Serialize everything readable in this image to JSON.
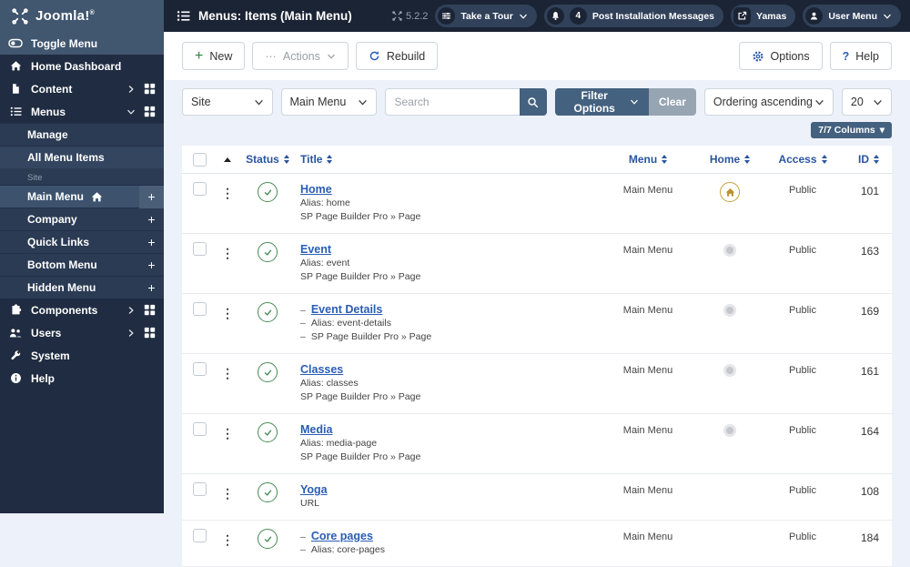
{
  "topbar": {
    "logo": "Joomla!",
    "logo_reg": "®",
    "title": "Menus: Items (Main Menu)",
    "version": "5.2.2",
    "take_a_tour": "Take a Tour",
    "messages_count": "4",
    "messages_label": "Post Installation Messages",
    "site_link": "Yamas",
    "user_menu": "User Menu"
  },
  "sidebar": {
    "toggle_label": "Toggle Menu",
    "home_dashboard": "Home Dashboard",
    "content": "Content",
    "menus": "Menus",
    "manage": "Manage",
    "all_menu_items": "All Menu Items",
    "site_section": "Site",
    "site_menus": [
      {
        "label": "Main Menu"
      },
      {
        "label": "Company"
      },
      {
        "label": "Quick Links"
      },
      {
        "label": "Bottom Menu"
      },
      {
        "label": "Hidden Menu"
      }
    ],
    "add_label": "+",
    "components": "Components",
    "users": "Users",
    "system": "System",
    "help": "Help"
  },
  "toolbar": {
    "new_label": "New",
    "new_plus": "+",
    "actions_label": "Actions",
    "actions_dots": "···",
    "rebuild_label": "Rebuild",
    "options_label": "Options",
    "help_label": "Help",
    "help_qmark": "?"
  },
  "filters": {
    "site_select": "Site",
    "menu_select": "Main Menu",
    "search_placeholder": "Search",
    "filter_options": "Filter Options",
    "clear": "Clear",
    "ordering_select": "Ordering ascending",
    "limit_select": "20",
    "columns_button": "7/7 Columns",
    "columns_caret": "▾"
  },
  "table": {
    "dash": "–",
    "headers": {
      "status": "Status",
      "title": "Title",
      "menu": "Menu",
      "home": "Home",
      "access": "Access",
      "id": "ID"
    },
    "rows": [
      {
        "title": "Home",
        "sub1": "Alias: home",
        "sub2": "SP Page Builder Pro » Page",
        "menu": "Main Menu",
        "home": "default",
        "access": "Public",
        "id": "101"
      },
      {
        "title": "Event",
        "sub1": "Alias: event",
        "sub2": "SP Page Builder Pro » Page",
        "menu": "Main Menu",
        "home": "not-default",
        "access": "Public",
        "id": "163"
      },
      {
        "title": "Event Details",
        "sub1": "Alias: event-details",
        "sub2": "SP Page Builder Pro » Page",
        "menu": "Main Menu",
        "home": "not-default",
        "access": "Public",
        "id": "169",
        "child": true
      },
      {
        "title": "Classes",
        "sub1": "Alias: classes",
        "sub2": "SP Page Builder Pro » Page",
        "menu": "Main Menu",
        "home": "not-default",
        "access": "Public",
        "id": "161"
      },
      {
        "title": "Media",
        "sub1": "Alias: media-page",
        "sub2": "SP Page Builder Pro » Page",
        "menu": "Main Menu",
        "home": "not-default",
        "access": "Public",
        "id": "164"
      },
      {
        "title": "Yoga",
        "sub1": "URL",
        "menu": "Main Menu",
        "home": "none",
        "access": "Public",
        "id": "108"
      },
      {
        "title": "Core pages",
        "sub1": "Alias: core-pages",
        "menu": "Main Menu",
        "home": "none",
        "access": "Public",
        "id": "184",
        "child": true
      }
    ]
  }
}
